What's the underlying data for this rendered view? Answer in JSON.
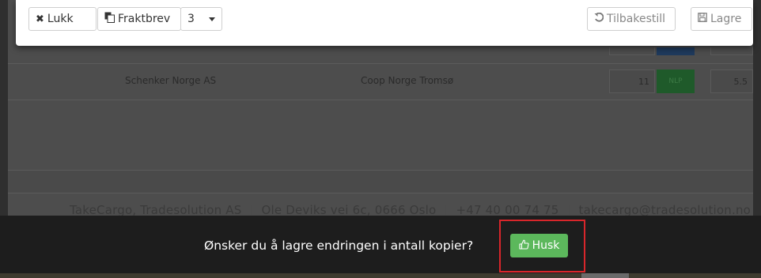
{
  "toolbar": {
    "close_label": "Lukk",
    "waybill_label": "Fraktbrev",
    "copies_value": "3",
    "reset_label": "Tilbakestill",
    "save_label": "Lagre",
    "icons": {
      "close": "times-icon",
      "waybill": "copy-icon",
      "reset": "undo-icon",
      "save": "floppy-disk-icon"
    }
  },
  "table": {
    "row": {
      "carrier": "Schenker Norge AS",
      "receiver": "Coop Norge Tromsø",
      "quantity": "11",
      "unit_badge": "NLP",
      "weight": "5.5"
    }
  },
  "footer": {
    "company": "TakeCargo, Tradesolution AS",
    "address": "Ole Deviks vei 6c, 0666 Oslo",
    "phone": "+47 40 00 74 75",
    "email": "takecargo@tradesolution.no"
  },
  "prompt": {
    "message": "Ønsker du å lagre endringen i antall kopier?",
    "confirm_label": "Husk",
    "confirm_icon": "thumbs-up-icon",
    "confirm_color": "#5cb85c"
  },
  "colors": {
    "highlight": "#d9262b",
    "prompt_bg": "#1d1d1d"
  }
}
